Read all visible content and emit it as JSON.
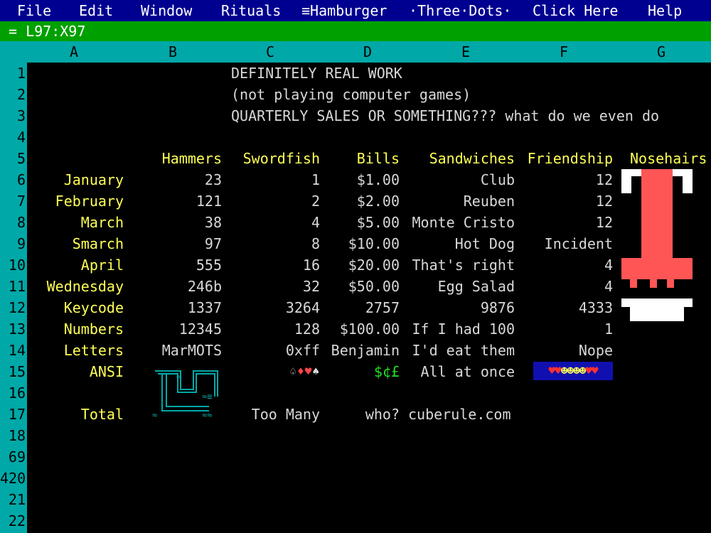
{
  "menu": [
    {
      "id": "file",
      "label": "File"
    },
    {
      "id": "edit",
      "label": "Edit"
    },
    {
      "id": "window",
      "label": "Window"
    },
    {
      "id": "rituals",
      "label": "Rituals"
    },
    {
      "id": "hamburger",
      "label": "≡Hamburger"
    },
    {
      "id": "three-dots",
      "label": "·Three·Dots·"
    },
    {
      "id": "click-here",
      "label": "Click Here"
    },
    {
      "id": "help",
      "label": "Help"
    }
  ],
  "formula_bar": "= L97:X97",
  "columns": [
    "A",
    "B",
    "C",
    "D",
    "E",
    "F",
    "G"
  ],
  "rows": [
    "1",
    "2",
    "3",
    "4",
    "5",
    "6",
    "7",
    "8",
    "9",
    "10",
    "11",
    "12",
    "13",
    "14",
    "15",
    "16",
    "17",
    "18",
    "69",
    "420",
    "21",
    "22"
  ],
  "title_lines": [
    "DEFINITELY REAL WORK",
    "(not playing computer games)",
    "QUARTERLY SALES OR SOMETHING??? what do we even do"
  ],
  "headers": [
    "Hammers",
    "Swordfish",
    "Bills",
    "Sandwiches",
    "Friendship",
    "Nosehairs"
  ],
  "data_rows": [
    {
      "label": "January",
      "hammers": "23",
      "swordfish": "1",
      "bills": "$1.00",
      "sandwiches": "Club",
      "friendship": "12"
    },
    {
      "label": "February",
      "hammers": "121",
      "swordfish": "2",
      "bills": "$2.00",
      "sandwiches": "Reuben",
      "friendship": "12"
    },
    {
      "label": "March",
      "hammers": "38",
      "swordfish": "4",
      "bills": "$5.00",
      "sandwiches": "Monte Cristo",
      "friendship": "12"
    },
    {
      "label": "Smarch",
      "hammers": "97",
      "swordfish": "8",
      "bills": "$10.00",
      "sandwiches": "Hot Dog",
      "friendship": "Incident"
    },
    {
      "label": "April",
      "hammers": "555",
      "swordfish": "16",
      "bills": "$20.00",
      "sandwiches": "That's right",
      "friendship": "4"
    },
    {
      "label": "Wednesday",
      "hammers": "246b",
      "swordfish": "32",
      "bills": "$50.00",
      "sandwiches": "Egg Salad",
      "friendship": "4"
    },
    {
      "label": "Keycode",
      "hammers": "1337",
      "swordfish": "3264",
      "bills": "2757",
      "sandwiches": "9876",
      "friendship": "4333"
    },
    {
      "label": "Numbers",
      "hammers": "12345",
      "swordfish": "128",
      "bills": "$100.00",
      "sandwiches": "If I had 100",
      "friendship": "1"
    },
    {
      "label": "Letters",
      "hammers": "MarMOTS",
      "swordfish": "0xff",
      "bills": "Benjamin",
      "sandwiches": "I'd eat them",
      "friendship": "Nope"
    }
  ],
  "ansi_row": {
    "label": "ANSI",
    "suits": [
      "♤",
      "♦",
      "♥",
      "♠"
    ],
    "currency": "$¢£",
    "sandwiches": "All at once",
    "friendship": "♥♥☻☻☻☻♥♥"
  },
  "total_row": {
    "label": "Total",
    "swordfish": "Too Many",
    "bills": "who?",
    "sandwiches": "cuberule.com"
  },
  "colors": {
    "menubar": "#000090",
    "formula": "#00a000",
    "headers": "#00a8a8",
    "label_text": "#ffff55",
    "cell_text": "#d8d8d8",
    "nose": "#ff5555"
  },
  "icons": {
    "ansi_art": "box-drawing-art-icon",
    "nosehairs": "nose-pixel-art-icon"
  }
}
